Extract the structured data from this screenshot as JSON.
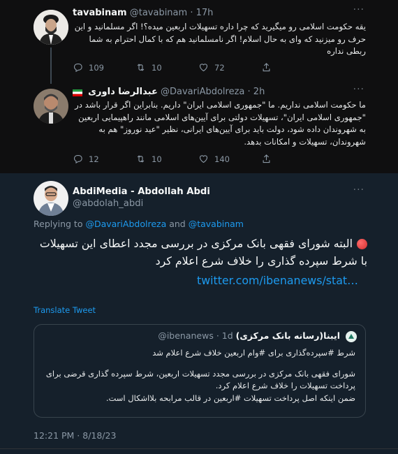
{
  "tweet1": {
    "display_name": "tavabinam",
    "handle": "@tavabinam",
    "time": "17h",
    "text": "یقه حکومت اسلامی رو میگیرید که چرا داره تسهیلات اربعین میده؟! اگر مسلمانید و این حرف رو میزنید که وای به حال اسلام! اگر نامسلمانید هم که با کمال احترام به شما ربطی نداره",
    "replies": "109",
    "retweets": "10",
    "likes": "72"
  },
  "tweet2": {
    "display_name": "عبدالرضا داوری",
    "handle": "@DavariAbdolreza",
    "time": "2h",
    "text": "ما حکومت اسلامی نداریم. ما \"جمهوری اسلامی ایران\" داریم. بنابراین اگر قرار باشد در \"جمهوری اسلامی ایران\"، تسهیلات دولتی برای آیین‌های اسلامی مانند راهپیمایی اربعین به شهروندان داده شود، دولت باید برای آیین‌های ایرانی، نظیر \"عید نوروز\" هم به شهروندان، تسهیلات و امکانات بدهد.",
    "replies": "12",
    "retweets": "10",
    "likes": "140"
  },
  "main_tweet": {
    "display_name": "AbdiMedia - Abdollah Abdi",
    "handle": "@abdolah_abdi",
    "replying_prefix": "Replying to ",
    "reply_user1": "@DavariAbdolreza",
    "reply_and": " and ",
    "reply_user2": "@tavabinam",
    "text": "البته شورای فقهی بانک مرکزی در بررسی مجدد اعطای این تسهیلات با شرط سپرده گذاری را خلاف شرع اعلام کرد",
    "link": "twitter.com/ibenanews/stat…",
    "translate": "Translate Tweet",
    "timestamp": "12:21 PM · 8/18/23"
  },
  "quote": {
    "display_name": "ایبنا(رسانه بانک مرکزی)",
    "handle": "@ibenanews",
    "time": "1d",
    "line1": "شرط #سپرده‌گذاری برای #وام اربعین خلاف شرع اعلام شد",
    "line2": "شورای فقهی بانک مرکزی در بررسی مجدد تسهیلات اربعین، شرط سپرده گذاری قرضی برای پرداخت تسهیلات را خلاف شرع اعلام کرد.",
    "line3": "ضمن اینکه اصل پرداخت تسهیلات #اربعین در قالب مرابحه بلااشکال است."
  },
  "colors": {
    "accent": "#1d9bf0",
    "background": "#15202b",
    "muted": "#8b98a5"
  }
}
